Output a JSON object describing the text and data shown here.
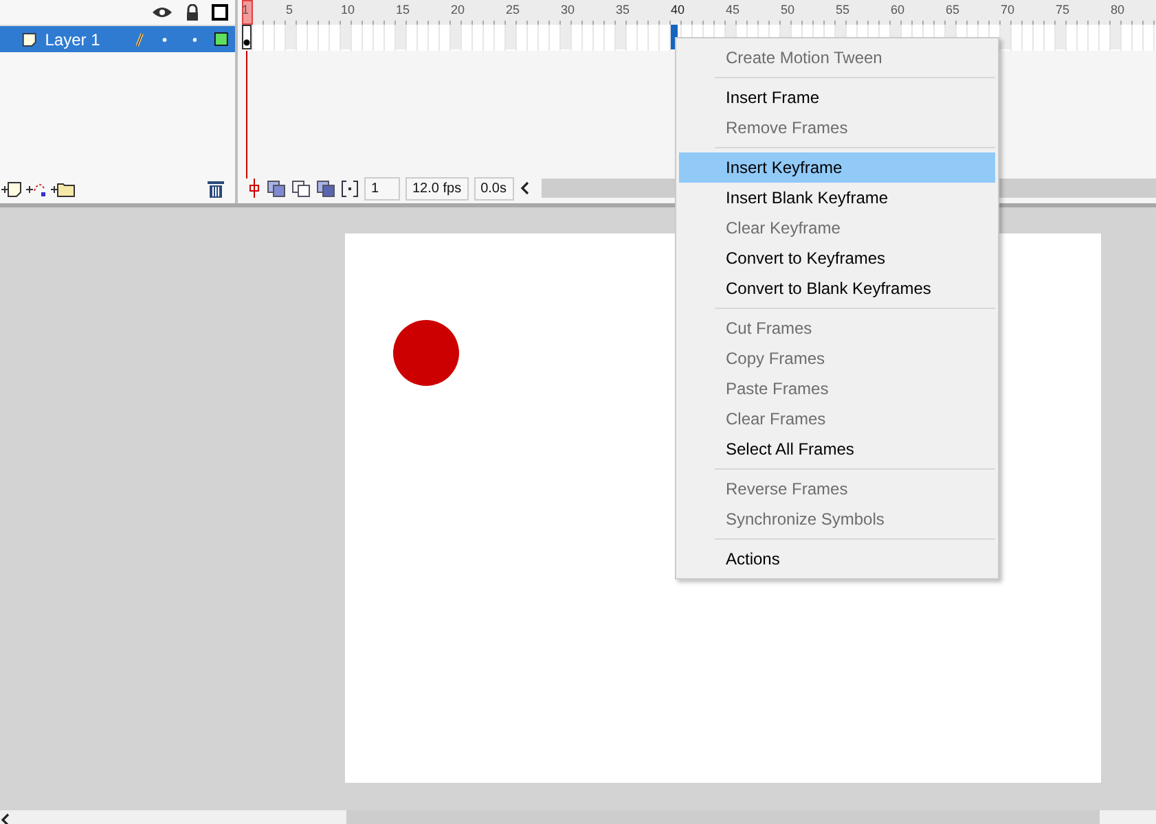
{
  "timeline": {
    "ruler": [
      {
        "label": "1",
        "selected": false
      },
      {
        "label": "5",
        "selected": false
      },
      {
        "label": "10",
        "selected": false
      },
      {
        "label": "15",
        "selected": false
      },
      {
        "label": "20",
        "selected": false
      },
      {
        "label": "25",
        "selected": false
      },
      {
        "label": "30",
        "selected": false
      },
      {
        "label": "35",
        "selected": false
      },
      {
        "label": "40",
        "selected": true
      },
      {
        "label": "45",
        "selected": false
      },
      {
        "label": "50",
        "selected": false
      },
      {
        "label": "55",
        "selected": false
      },
      {
        "label": "60",
        "selected": false
      },
      {
        "label": "65",
        "selected": false
      },
      {
        "label": "70",
        "selected": false
      },
      {
        "label": "75",
        "selected": false
      },
      {
        "label": "80",
        "selected": false
      }
    ],
    "layers": [
      {
        "name": "Layer 1",
        "selected": true
      }
    ],
    "frame_field": "1",
    "fps": "12.0 fps",
    "time": "0.0s"
  },
  "context_menu": [
    {
      "kind": "item",
      "label": "Create Motion Tween",
      "disabled": true,
      "selected": false
    },
    {
      "kind": "separator"
    },
    {
      "kind": "item",
      "label": "Insert Frame",
      "disabled": false,
      "selected": false
    },
    {
      "kind": "item",
      "label": "Remove Frames",
      "disabled": true,
      "selected": false
    },
    {
      "kind": "separator"
    },
    {
      "kind": "item",
      "label": "Insert Keyframe",
      "disabled": false,
      "selected": true
    },
    {
      "kind": "item",
      "label": "Insert Blank Keyframe",
      "disabled": false,
      "selected": false
    },
    {
      "kind": "item",
      "label": "Clear Keyframe",
      "disabled": true,
      "selected": false
    },
    {
      "kind": "item",
      "label": "Convert to Keyframes",
      "disabled": false,
      "selected": false
    },
    {
      "kind": "item",
      "label": "Convert to Blank Keyframes",
      "disabled": false,
      "selected": false
    },
    {
      "kind": "separator"
    },
    {
      "kind": "item",
      "label": "Cut Frames",
      "disabled": true,
      "selected": false
    },
    {
      "kind": "item",
      "label": "Copy Frames",
      "disabled": true,
      "selected": false
    },
    {
      "kind": "item",
      "label": "Paste Frames",
      "disabled": true,
      "selected": false
    },
    {
      "kind": "item",
      "label": "Clear Frames",
      "disabled": true,
      "selected": false
    },
    {
      "kind": "item",
      "label": "Select All Frames",
      "disabled": false,
      "selected": false
    },
    {
      "kind": "separator"
    },
    {
      "kind": "item",
      "label": "Reverse Frames",
      "disabled": true,
      "selected": false
    },
    {
      "kind": "item",
      "label": "Synchronize Symbols",
      "disabled": true,
      "selected": false
    },
    {
      "kind": "separator"
    },
    {
      "kind": "item",
      "label": "Actions",
      "disabled": false,
      "selected": false
    }
  ]
}
